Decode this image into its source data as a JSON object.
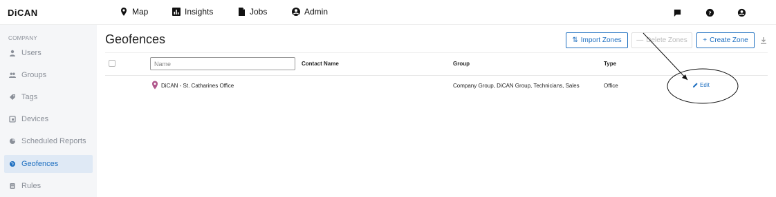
{
  "app": {
    "logo": "DiCAN"
  },
  "nav": [
    {
      "label": "Map",
      "icon": "map-pin-icon"
    },
    {
      "label": "Insights",
      "icon": "chart-icon"
    },
    {
      "label": "Jobs",
      "icon": "document-icon"
    },
    {
      "label": "Admin",
      "icon": "account-circle-icon"
    }
  ],
  "top_icons": [
    "chat-icon",
    "help-icon",
    "account-icon"
  ],
  "sidebar": {
    "section": "COMPANY",
    "items": [
      {
        "label": "Users",
        "icon": "person-icon"
      },
      {
        "label": "Groups",
        "icon": "people-icon"
      },
      {
        "label": "Tags",
        "icon": "tag-icon"
      },
      {
        "label": "Devices",
        "icon": "device-icon"
      },
      {
        "label": "Scheduled Reports",
        "icon": "pie-icon"
      },
      {
        "label": "Geofences",
        "icon": "globe-icon",
        "active": true
      },
      {
        "label": "Rules",
        "icon": "rules-icon"
      }
    ]
  },
  "page": {
    "title": "Geofences",
    "import_label": "Import Zones",
    "delete_label": "Delete Zones",
    "create_label": "Create Zone"
  },
  "table": {
    "name_placeholder": "Name",
    "columns": {
      "contact": "Contact Name",
      "group": "Group",
      "type": "Type"
    },
    "rows": [
      {
        "name": "DiCAN - St. Catharines Office",
        "contact": "",
        "group": "Company Group, DiCAN Group, Technicians, Sales",
        "type": "Office",
        "action": "Edit"
      }
    ]
  },
  "colors": {
    "accent": "#1e6fc0",
    "sidebar_bg": "#f5f6f8",
    "active_bg": "#dfe9f5",
    "pin": "#b0578c"
  }
}
